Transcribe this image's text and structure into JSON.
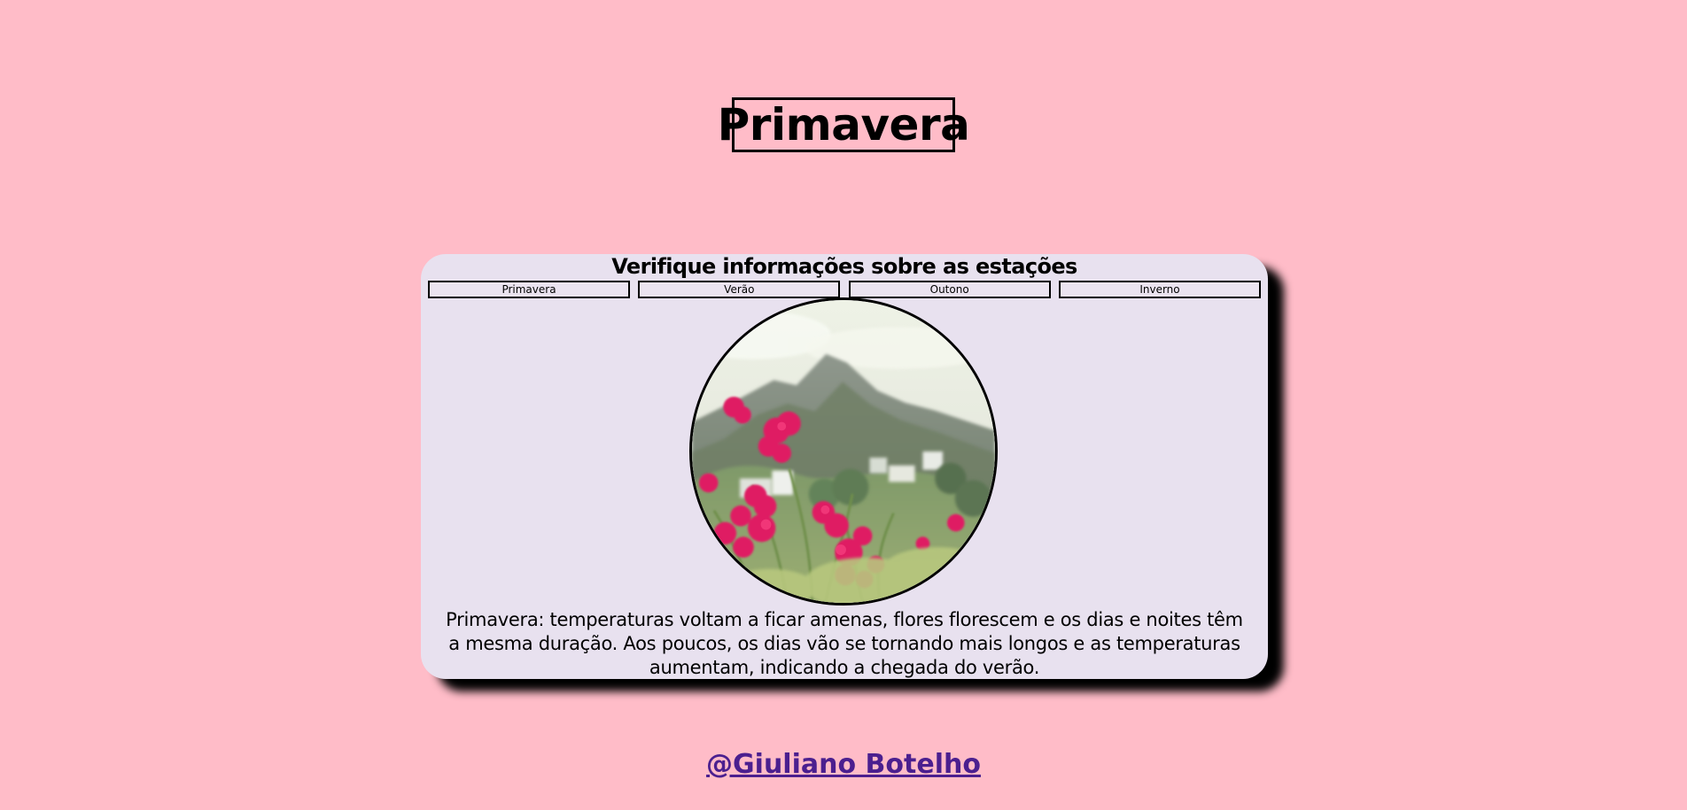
{
  "page": {
    "title": "Primavera",
    "background_color": "#ffbcc8"
  },
  "card": {
    "heading": "Verifique informações sobre as estações",
    "background_color": "#e8e1ef",
    "tabs": [
      {
        "label": "Primavera"
      },
      {
        "label": "Verão"
      },
      {
        "label": "Outono"
      },
      {
        "label": "Inverno"
      }
    ],
    "image": {
      "subject": "pink flowers with mountain background",
      "icon": "season-photo"
    },
    "description": "Primavera: temperaturas voltam a ficar amenas, flores florescem e os dias e noites têm a mesma duração. Aos poucos, os dias vão se tornando mais longos e as temperaturas aumentam, indicando a chegada do verão."
  },
  "footer": {
    "credit": "@Giuliano Botelho",
    "link_color": "#4b1f8f"
  }
}
